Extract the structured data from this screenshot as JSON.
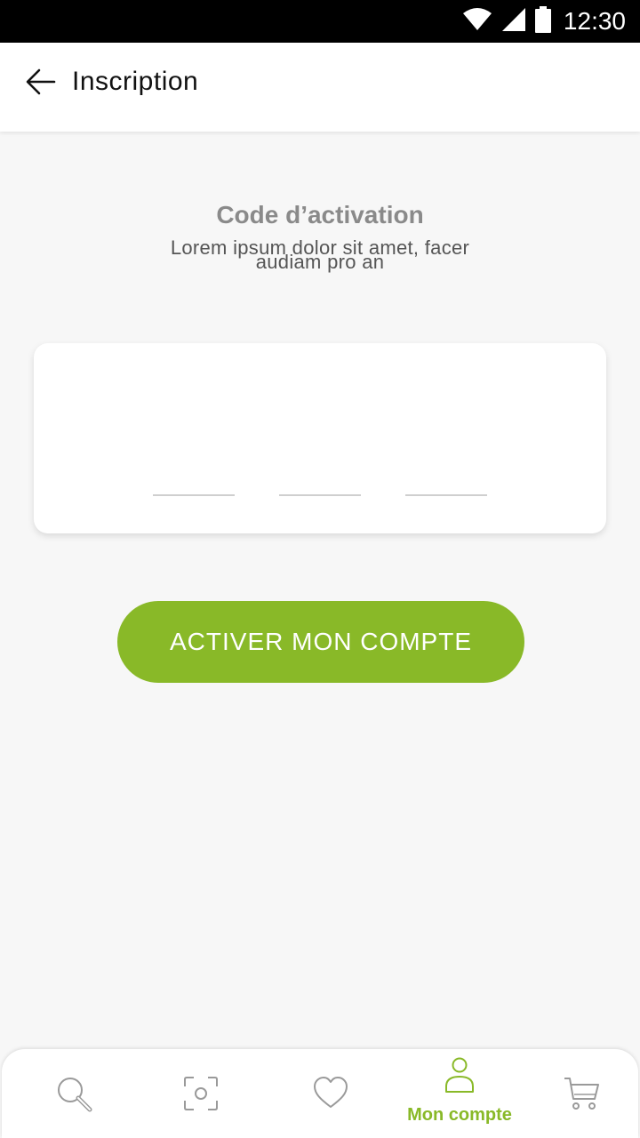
{
  "status_bar": {
    "time": "12:30"
  },
  "app_bar": {
    "title": "Inscription"
  },
  "activation": {
    "title": "Code d’activation",
    "description_line1": "Lorem ipsum dolor sit amet, facer",
    "description_line2": "audiam pro an"
  },
  "code_fields": [
    {
      "value": "",
      "placeholder": ""
    },
    {
      "value": "",
      "placeholder": ""
    },
    {
      "value": "",
      "placeholder": ""
    }
  ],
  "cta": {
    "label": "ACTIVER MON COMPTE"
  },
  "bottom_nav": {
    "items": [
      {
        "icon": "search-icon"
      },
      {
        "icon": "scan-icon"
      },
      {
        "icon": "heart-icon"
      },
      {
        "icon": "user-icon",
        "label": "Mon compte",
        "active": true
      },
      {
        "icon": "cart-icon"
      }
    ]
  },
  "colors": {
    "accent": "#89b928",
    "title_gray": "#8a8a8a",
    "status_bar": "#000000",
    "background": "#f7f7f7"
  }
}
